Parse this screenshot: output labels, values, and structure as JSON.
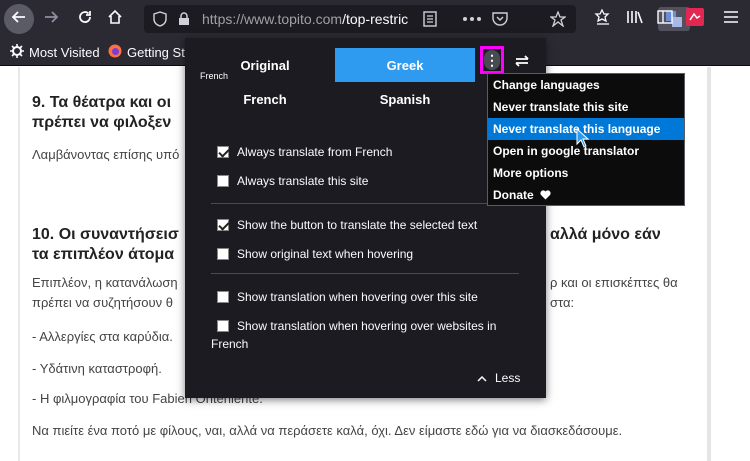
{
  "toolbar": {
    "url_host": "https://www.topito.com",
    "url_path": "/top-restric"
  },
  "bookmarks": [
    {
      "label": "Most Visited",
      "icon": "gear-icon"
    },
    {
      "label": "Getting Sta",
      "icon": "firefox-icon"
    }
  ],
  "article": {
    "h9_line1": "9. Τα θέατρα και οι",
    "h9_line2": "πρέπει να φιλοξεν",
    "p9": "Λαμβάνοντας επίσης υπό",
    "h10_line1": "10. Οι συναντήσεισ",
    "h10_line1b": "αλλά μόνο εάν",
    "h10_line2": "τα επιπλέον άτομα",
    "p10a_start": "Επιπλέον, η κατανάλωση",
    "p10a_end": "ρ και οι επισκέπτες θα",
    "p10b_start": "πρέπει να συζητήσουν θ",
    "p10b_end": "στα:",
    "list1": "- Αλλεργίες στα καρύδια.",
    "list2": "- Υδάτινη καταστροφή.",
    "list3": "- Η φιλμογραφία του Fabien Onteniente.",
    "closing": "Να πιείτε ένα ποτό με φίλους, ναι, αλλά να περάσετε καλά, όχι. Δεν είμαστε εδώ για να διασκεδάσουμε."
  },
  "panel": {
    "source_language": "French",
    "tabs": [
      "Original",
      "Greek",
      "French",
      "Spanish"
    ],
    "options_group1": [
      {
        "label": "Always translate from French",
        "checked": true
      },
      {
        "label": "Always translate this site",
        "checked": false
      }
    ],
    "options_group2": [
      {
        "label": "Show the button to translate the selected text",
        "checked": true
      },
      {
        "label": "Show original text when hovering",
        "checked": false
      }
    ],
    "options_group3": [
      {
        "label": "Show translation when hovering over this site",
        "checked": false
      },
      {
        "label": "Show translation when hovering over websites in",
        "checked": false
      }
    ],
    "wrap_word": "French",
    "less_label": "Less"
  },
  "dropdown": {
    "items": [
      "Change languages",
      "Never translate this site",
      "Never translate this language",
      "Open in google translator",
      "More options",
      "Donate"
    ],
    "highlighted_index": 2
  },
  "colors": {
    "accent": "#2e9bf0",
    "highlight": "#0078d7",
    "focus_ring": "#ff00ff",
    "panel_bg": "#1c1b22"
  }
}
